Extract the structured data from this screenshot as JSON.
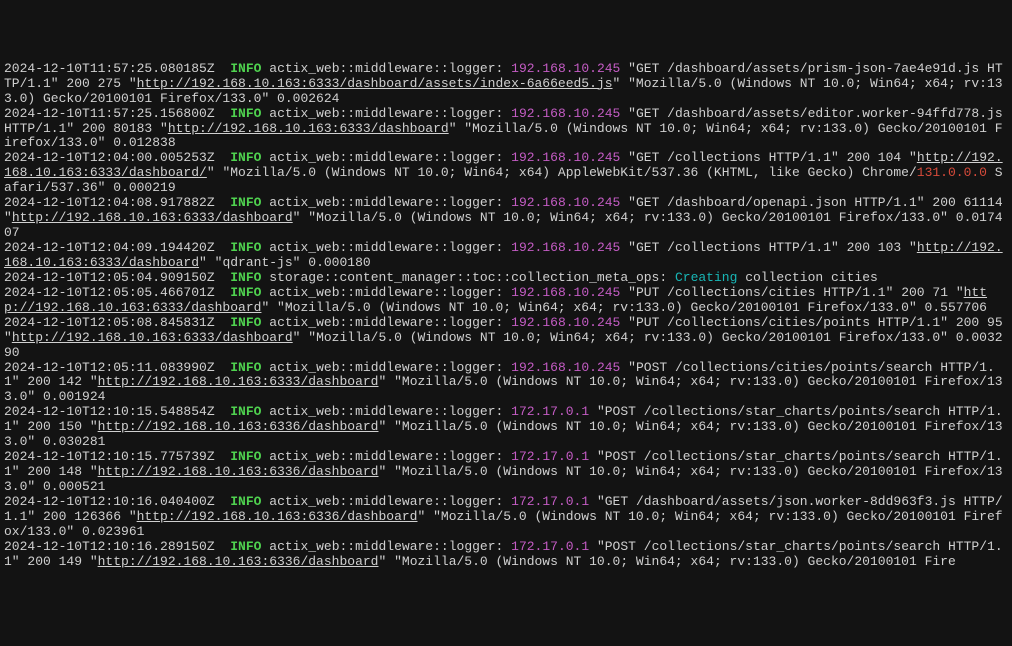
{
  "colors": {
    "bg": "#131313",
    "text": "#d0d0d0",
    "level_info": "#4fd24f",
    "ip": "#c45cc4",
    "action": "#18b6b6",
    "red": "#d64a3a"
  },
  "log": [
    {
      "type": "entry",
      "ts": "2024-12-10T11:57:25.080185Z",
      "level": "INFO",
      "module": "actix_web::middleware::logger:",
      "ip": "192.168.10.245",
      "pre_url": " \"GET /dashboard/assets/prism-json-7ae4e91d.js HTTP/1.1\" 200 275 \"",
      "url": "http://192.168.10.163:6333/dashboard/assets/index-6a66eed5.js",
      "post_url": "\" \"Mozilla/5.0 (Windows NT 10.0; Win64; x64; rv:133.0) Gecko/20100101 Firefox/133.0\" 0.002624"
    },
    {
      "type": "entry",
      "ts": "2024-12-10T11:57:25.156800Z",
      "level": "INFO",
      "module": "actix_web::middleware::logger:",
      "ip": "192.168.10.245",
      "pre_url": " \"GET /dashboard/assets/editor.worker-94ffd778.js HTTP/1.1\" 200 80183 \"",
      "url": "http://192.168.10.163:6333/dashboard",
      "post_url": "\" \"Mozilla/5.0 (Windows NT 10.0; Win64; x64; rv:133.0) Gecko/20100101 Firefox/133.0\" 0.012838"
    },
    {
      "type": "entry",
      "ts": "2024-12-10T12:04:00.005253Z",
      "level": "INFO",
      "module": "actix_web::middleware::logger:",
      "ip": "192.168.10.245",
      "pre_url": " \"GET /collections HTTP/1.1\" 200 104 \"",
      "url": "http://192.168.10.163:6333/dashboard/",
      "post_url": "\" \"Mozilla/5.0 (Windows NT 10.0; Win64; x64) AppleWebKit/537.36 (KHTML, like Gecko) Chrome/",
      "red": "131.0.0.0",
      "post_red": " Safari/537.36\" 0.000219"
    },
    {
      "type": "entry",
      "ts": "2024-12-10T12:04:08.917882Z",
      "level": "INFO",
      "module": "actix_web::middleware::logger:",
      "ip": "192.168.10.245",
      "pre_url": " \"GET /dashboard/openapi.json HTTP/1.1\" 200 61114 \"",
      "url": "http://192.168.10.163:6333/dashboard",
      "post_url": "\" \"Mozilla/5.0 (Windows NT 10.0; Win64; x64; rv:133.0) Gecko/20100101 Firefox/133.0\" 0.017407"
    },
    {
      "type": "entry",
      "ts": "2024-12-10T12:04:09.194420Z",
      "level": "INFO",
      "module": "actix_web::middleware::logger:",
      "ip": "192.168.10.245",
      "pre_url": " \"GET /collections HTTP/1.1\" 200 103 \"",
      "url": "http://192.168.10.163:6333/dashboard",
      "post_url": "\" \"qdrant-js\" 0.000180"
    },
    {
      "type": "entry",
      "ts": "2024-12-10T12:05:04.909150Z",
      "level": "INFO",
      "module": "storage::content_manager::toc::collection_meta_ops:",
      "action": "Creating",
      "post_action": " collection cities"
    },
    {
      "type": "entry",
      "ts": "2024-12-10T12:05:05.466701Z",
      "level": "INFO",
      "module": "actix_web::middleware::logger:",
      "ip": "192.168.10.245",
      "pre_url": " \"PUT /collections/cities HTTP/1.1\" 200 71 \"",
      "url": "http://192.168.10.163:6333/dashboard",
      "post_url": "\" \"Mozilla/5.0 (Windows NT 10.0; Win64; x64; rv:133.0) Gecko/20100101 Firefox/133.0\" 0.557706"
    },
    {
      "type": "entry",
      "ts": "2024-12-10T12:05:08.845831Z",
      "level": "INFO",
      "module": "actix_web::middleware::logger:",
      "ip": "192.168.10.245",
      "pre_url": " \"PUT /collections/cities/points HTTP/1.1\" 200 95 \"",
      "url": "http://192.168.10.163:6333/dashboard",
      "post_url": "\" \"Mozilla/5.0 (Windows NT 10.0; Win64; x64; rv:133.0) Gecko/20100101 Firefox/133.0\" 0.003290"
    },
    {
      "type": "entry",
      "ts": "2024-12-10T12:05:11.083990Z",
      "level": "INFO",
      "module": "actix_web::middleware::logger:",
      "ip": "192.168.10.245",
      "pre_url": " \"POST /collections/cities/points/search HTTP/1.1\" 200 142 \"",
      "url": "http://192.168.10.163:6333/dashboard",
      "post_url": "\" \"Mozilla/5.0 (Windows NT 10.0; Win64; x64; rv:133.0) Gecko/20100101 Firefox/133.0\" 0.001924"
    },
    {
      "type": "entry",
      "ts": "2024-12-10T12:10:15.548854Z",
      "level": "INFO",
      "module": "actix_web::middleware::logger:",
      "ip": "172.17.0.1",
      "pre_url": " \"POST /collections/star_charts/points/search HTTP/1.1\" 200 150 \"",
      "url": "http://192.168.10.163:6336/dashboard",
      "post_url": "\" \"Mozilla/5.0 (Windows NT 10.0; Win64; x64; rv:133.0) Gecko/20100101 Firefox/133.0\" 0.030281"
    },
    {
      "type": "entry",
      "ts": "2024-12-10T12:10:15.775739Z",
      "level": "INFO",
      "module": "actix_web::middleware::logger:",
      "ip": "172.17.0.1",
      "pre_url": " \"POST /collections/star_charts/points/search HTTP/1.1\" 200 148 \"",
      "url": "http://192.168.10.163:6336/dashboard",
      "post_url": "\" \"Mozilla/5.0 (Windows NT 10.0; Win64; x64; rv:133.0) Gecko/20100101 Firefox/133.0\" 0.000521"
    },
    {
      "type": "entry",
      "ts": "2024-12-10T12:10:16.040400Z",
      "level": "INFO",
      "module": "actix_web::middleware::logger:",
      "ip": "172.17.0.1",
      "pre_url": " \"GET /dashboard/assets/json.worker-8dd963f3.js HTTP/1.1\" 200 126366 \"",
      "url": "http://192.168.10.163:6336/dashboard",
      "post_url": "\" \"Mozilla/5.0 (Windows NT 10.0; Win64; x64; rv:133.0) Gecko/20100101 Firefox/133.0\" 0.023961"
    },
    {
      "type": "entry",
      "ts": "2024-12-10T12:10:16.289150Z",
      "level": "INFO",
      "module": "actix_web::middleware::logger:",
      "ip": "172.17.0.1",
      "pre_url": " \"POST /collections/star_charts/points/search HTTP/1.1\" 200 149 \"",
      "url": "http://192.168.10.163:6336/dashboard",
      "post_url": "\" \"Mozilla/5.0 (Windows NT 10.0; Win64; x64; rv:133.0) Gecko/20100101 Fire"
    }
  ]
}
